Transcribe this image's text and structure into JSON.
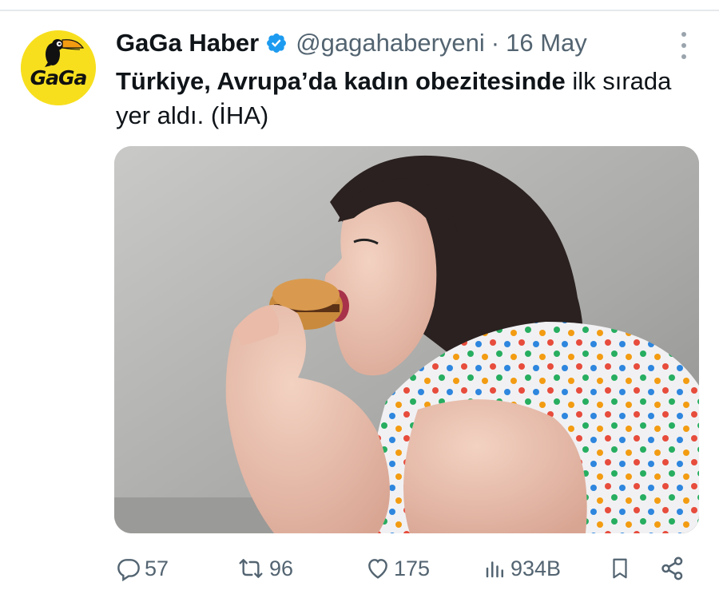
{
  "author": {
    "display_name": "GaGa Haber",
    "handle": "@gagahaberyeni",
    "separator": "·",
    "date": "16 May",
    "verified": true,
    "avatar_text": "GaGa"
  },
  "tweet": {
    "text_bold": "Türkiye, Avrupa’da kadın obezitesinde",
    "text_rest": " ilk sırada yer aldı. (İHA)"
  },
  "actions": {
    "replies": "57",
    "reposts": "96",
    "likes": "175",
    "views": "934B"
  },
  "colors": {
    "text_primary": "#0f1419",
    "text_secondary": "#536471",
    "verified_blue": "#1d9bf0",
    "avatar_yellow": "#f7df1e"
  }
}
